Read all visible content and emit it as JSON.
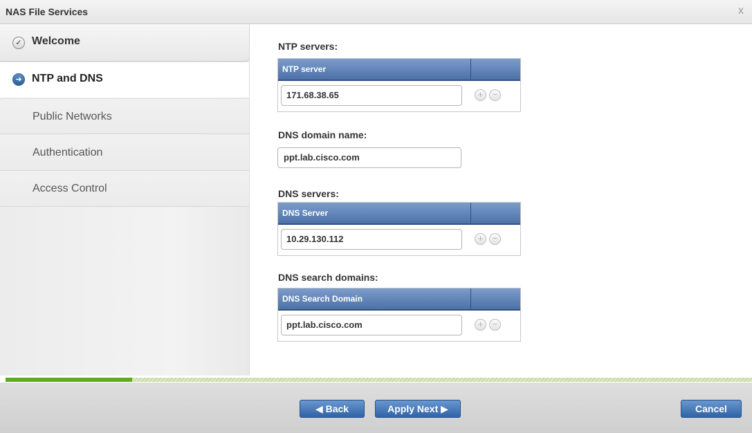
{
  "window": {
    "title": "NAS File Services",
    "close_glyph": "x"
  },
  "sidebar": {
    "items": [
      {
        "label": "Welcome",
        "icon": "check-circle-icon",
        "state": "completed"
      },
      {
        "label": "NTP and DNS",
        "icon": "arrow-circle-icon",
        "state": "current"
      },
      {
        "label": "Public Networks",
        "state": "pending"
      },
      {
        "label": "Authentication",
        "state": "pending"
      },
      {
        "label": "Access Control",
        "state": "pending"
      }
    ]
  },
  "main": {
    "ntp": {
      "section_label": "NTP servers:",
      "column_header": "NTP server",
      "value": "171.68.38.65"
    },
    "dns_domain": {
      "section_label": "DNS domain name:",
      "value": "ppt.lab.cisco.com"
    },
    "dns_servers": {
      "section_label": "DNS servers:",
      "column_header": "DNS Server",
      "value": "10.29.130.112"
    },
    "dns_search": {
      "section_label": "DNS search domains:",
      "column_header": "DNS Search Domain",
      "value": "ppt.lab.cisco.com"
    },
    "row_buttons": {
      "add_glyph": "+",
      "remove_glyph": "−"
    }
  },
  "progress": {
    "fraction": 0.17
  },
  "footer": {
    "back_label": "◀ Back",
    "apply_next_label": "Apply Next ▶",
    "cancel_label": "Cancel"
  },
  "colors": {
    "accent": "#4d72a8",
    "button": "#2f63a6",
    "progress_fill": "#5faa1f"
  }
}
